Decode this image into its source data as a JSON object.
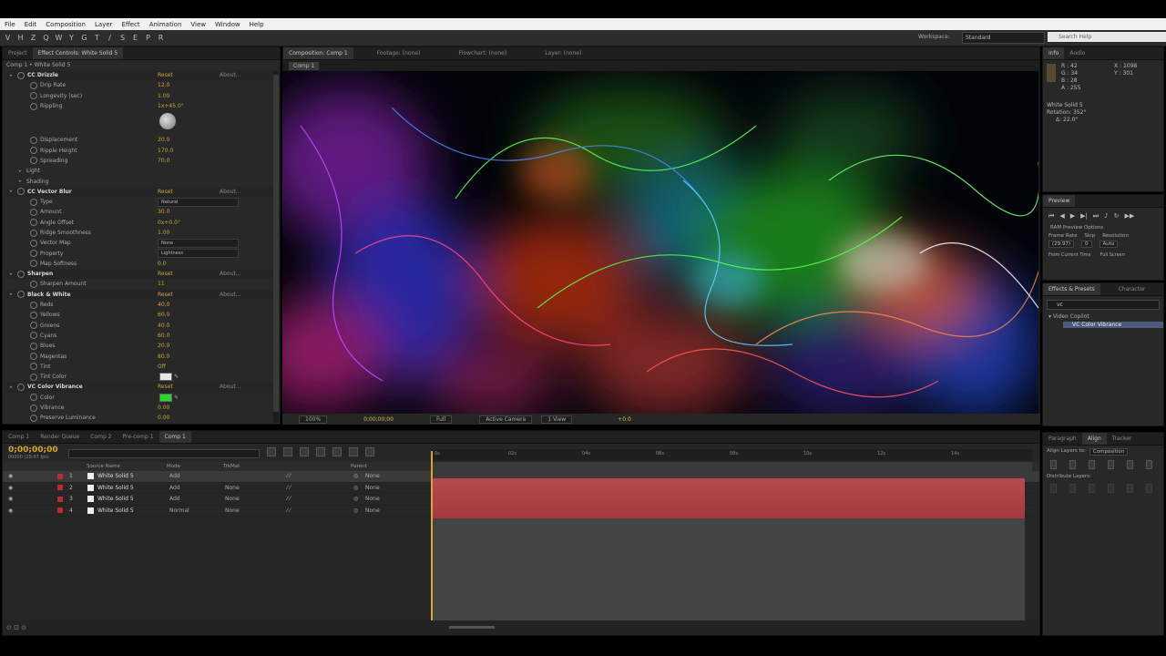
{
  "menu": [
    "File",
    "Edit",
    "Composition",
    "Layer",
    "Effect",
    "Animation",
    "View",
    "Window",
    "Help"
  ],
  "toolbar": {
    "tools": [
      "V",
      "H",
      "Z",
      "Q",
      "W",
      "Y",
      "G",
      "T",
      "/",
      "S",
      "E",
      "P",
      "R"
    ],
    "workspace_label": "Workspace:",
    "workspace_value": "Standard",
    "search_placeholder": "Search Help"
  },
  "left_panel": {
    "tabs": [
      "Project",
      "Effect Controls: White Solid 5"
    ],
    "subtitle": "Comp 1 • White Solid 5",
    "rows": [
      {
        "type": "hdr",
        "label": "CC Drizzle",
        "value": "Reset",
        "extra": "About..."
      },
      {
        "type": "prop",
        "label": "Drip Rate",
        "value": "12.0"
      },
      {
        "type": "prop",
        "label": "Longevity (sec)",
        "value": "1.00"
      },
      {
        "type": "prop",
        "label": "Rippling",
        "value": "1x+45.0°"
      },
      {
        "type": "knob"
      },
      {
        "type": "prop",
        "label": "Displacement",
        "value": "20.0"
      },
      {
        "type": "prop",
        "label": "Ripple Height",
        "value": "170.0"
      },
      {
        "type": "prop",
        "label": "Spreading",
        "value": "70.0"
      },
      {
        "type": "group",
        "label": "Light"
      },
      {
        "type": "group",
        "label": "Shading"
      },
      {
        "type": "hdr",
        "label": "CC Vector Blur",
        "value": "Reset",
        "extra": "About..."
      },
      {
        "type": "dd",
        "label": "Type",
        "value": "Natural"
      },
      {
        "type": "prop",
        "label": "Amount",
        "value": "30.0"
      },
      {
        "type": "prop",
        "label": "Angle Offset",
        "value": "0x+0.0°"
      },
      {
        "type": "prop",
        "label": "Ridge Smoothness",
        "value": "1.00"
      },
      {
        "type": "dd",
        "label": "Vector Map",
        "value": "None"
      },
      {
        "type": "dd",
        "label": "Property",
        "value": "Lightness"
      },
      {
        "type": "prop",
        "label": "Map Softness",
        "value": "0.0"
      },
      {
        "type": "hdr",
        "label": "Sharpen",
        "value": "Reset",
        "extra": "About..."
      },
      {
        "type": "prop",
        "label": "Sharpen Amount",
        "value": "11"
      },
      {
        "type": "hdr",
        "label": "Black & White",
        "value": "Reset",
        "extra": "About..."
      },
      {
        "type": "prop",
        "label": "Reds",
        "value": "40.0"
      },
      {
        "type": "prop",
        "label": "Yellows",
        "value": "60.0"
      },
      {
        "type": "prop",
        "label": "Greens",
        "value": "40.0"
      },
      {
        "type": "prop",
        "label": "Cyans",
        "value": "60.0"
      },
      {
        "type": "prop",
        "label": "Blues",
        "value": "20.0"
      },
      {
        "type": "prop",
        "label": "Magentas",
        "value": "80.0"
      },
      {
        "type": "prop",
        "label": "Tint",
        "value": "Off"
      },
      {
        "type": "swatch",
        "label": "Tint Color",
        "color": "#e8e8e8"
      },
      {
        "type": "hdr",
        "label": "VC Color Vibrance",
        "value": "Reset",
        "extra": "About..."
      },
      {
        "type": "swatch",
        "label": "Color",
        "color": "#29d829"
      },
      {
        "type": "prop",
        "label": "Vibrance",
        "value": "0.00"
      },
      {
        "type": "prop",
        "label": "Preserve Luminance",
        "value": "0.00"
      }
    ]
  },
  "comp_viewer": {
    "tabs": [
      "Composition: Comp 1",
      "Footage: (none)",
      "Flowchart: (none)",
      "Layer: (none)"
    ],
    "breadcrumb": "Comp 1",
    "zoom": "100%",
    "timecode": "0;00;00;00",
    "resolution": "Full",
    "camera": "Active Camera",
    "views": "1 View",
    "exposure": "+0.0"
  },
  "right_panels": {
    "info": {
      "tabs": [
        "Info",
        "Audio"
      ],
      "r": "R : 42",
      "g": "G : 34",
      "b": "B : 28",
      "a": "A : 255",
      "x": "X : 1098",
      "y": "Y : 301",
      "layer": "White Solid 5",
      "rotation": "Rotation: 352°",
      "delta": "Δ: 22.0°"
    },
    "preview": {
      "tab": "Preview",
      "ram_options": "RAM Preview Options",
      "frame_rate_label": "Frame Rate",
      "skip_label": "Skip",
      "resolution_label": "Resolution",
      "frame_rate": "(29.97)",
      "skip": "0",
      "resolution": "Auto",
      "from_current": "From Current Time",
      "full_screen": "Full Screen"
    },
    "effects": {
      "tabs": [
        "Effects & Presets",
        "Character"
      ],
      "search": "vc",
      "category": "Video Copilot",
      "item": "VC Color Vibrance"
    },
    "align": {
      "tabs": [
        "Paragraph",
        "Align",
        "Tracker"
      ],
      "align_to_label": "Align Layers to:",
      "align_to_value": "Composition",
      "distribute_label": "Distribute Layers:"
    }
  },
  "timeline": {
    "tabs": [
      "Comp 1",
      "Render Queue",
      "Comp 2",
      "Pre-comp 1",
      "Comp 1"
    ],
    "timecode": "0;00;00;00",
    "fps": "00000 (29.97 fps)",
    "columns": {
      "source": "Source Name",
      "mode": "Mode",
      "trkmat": "TrkMat",
      "parent": "Parent"
    },
    "ruler": [
      "0s",
      "02s",
      "04s",
      "06s",
      "08s",
      "10s",
      "12s",
      "14s"
    ],
    "layers": [
      {
        "num": "1",
        "name": "White Solid 5",
        "mode": "Add",
        "trkmat": "",
        "parent": "None"
      },
      {
        "num": "2",
        "name": "White Solid 5",
        "mode": "Add",
        "trkmat": "None",
        "parent": "None"
      },
      {
        "num": "3",
        "name": "White Solid 5",
        "mode": "Add",
        "trkmat": "None",
        "parent": "None"
      },
      {
        "num": "4",
        "name": "White Solid 5",
        "mode": "Normal",
        "trkmat": "None",
        "parent": "None"
      }
    ]
  }
}
